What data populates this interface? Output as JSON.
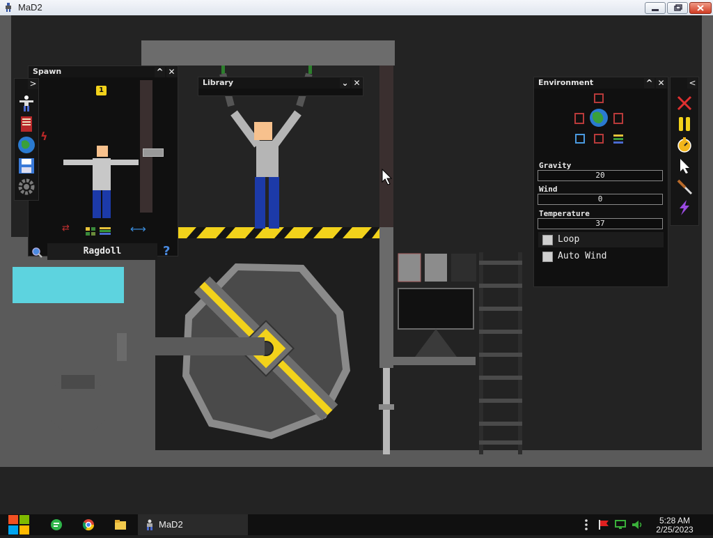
{
  "window": {
    "title": "MaD2",
    "min": "",
    "max": "",
    "close": ""
  },
  "spawn_panel": {
    "title": "Spawn",
    "collapse": "^",
    "close": "✕",
    "expand": ">",
    "count_badge": "1",
    "item_name": "Ragdoll",
    "help": "?",
    "tools": [
      "person-icon",
      "book-icon",
      "globe-icon",
      "save-icon",
      "gear-icon"
    ]
  },
  "library_panel": {
    "title": "Library",
    "dropdown": "⌄",
    "close": "✕"
  },
  "environment_panel": {
    "title": "Environment",
    "collapse": "^",
    "close": "✕",
    "gravity": {
      "label": "Gravity",
      "value": "20"
    },
    "wind": {
      "label": "Wind",
      "value": "0"
    },
    "temperature": {
      "label": "Temperature",
      "value": "37"
    },
    "loop": {
      "label": "Loop"
    },
    "auto_wind": {
      "label": "Auto Wind"
    }
  },
  "toolbar_right": {
    "collapse": "<",
    "tools": [
      "delete-icon",
      "pause-icon",
      "timer-icon",
      "pointer-icon",
      "knife-icon",
      "lightning-icon"
    ]
  },
  "taskbar": {
    "app_label": "MaD2",
    "time": "5:28 AM",
    "date": "2/25/2023"
  },
  "colors": {
    "hazard_yellow": "#f2d21b",
    "water": "#5dd3df",
    "ui_bg": "#101010"
  }
}
